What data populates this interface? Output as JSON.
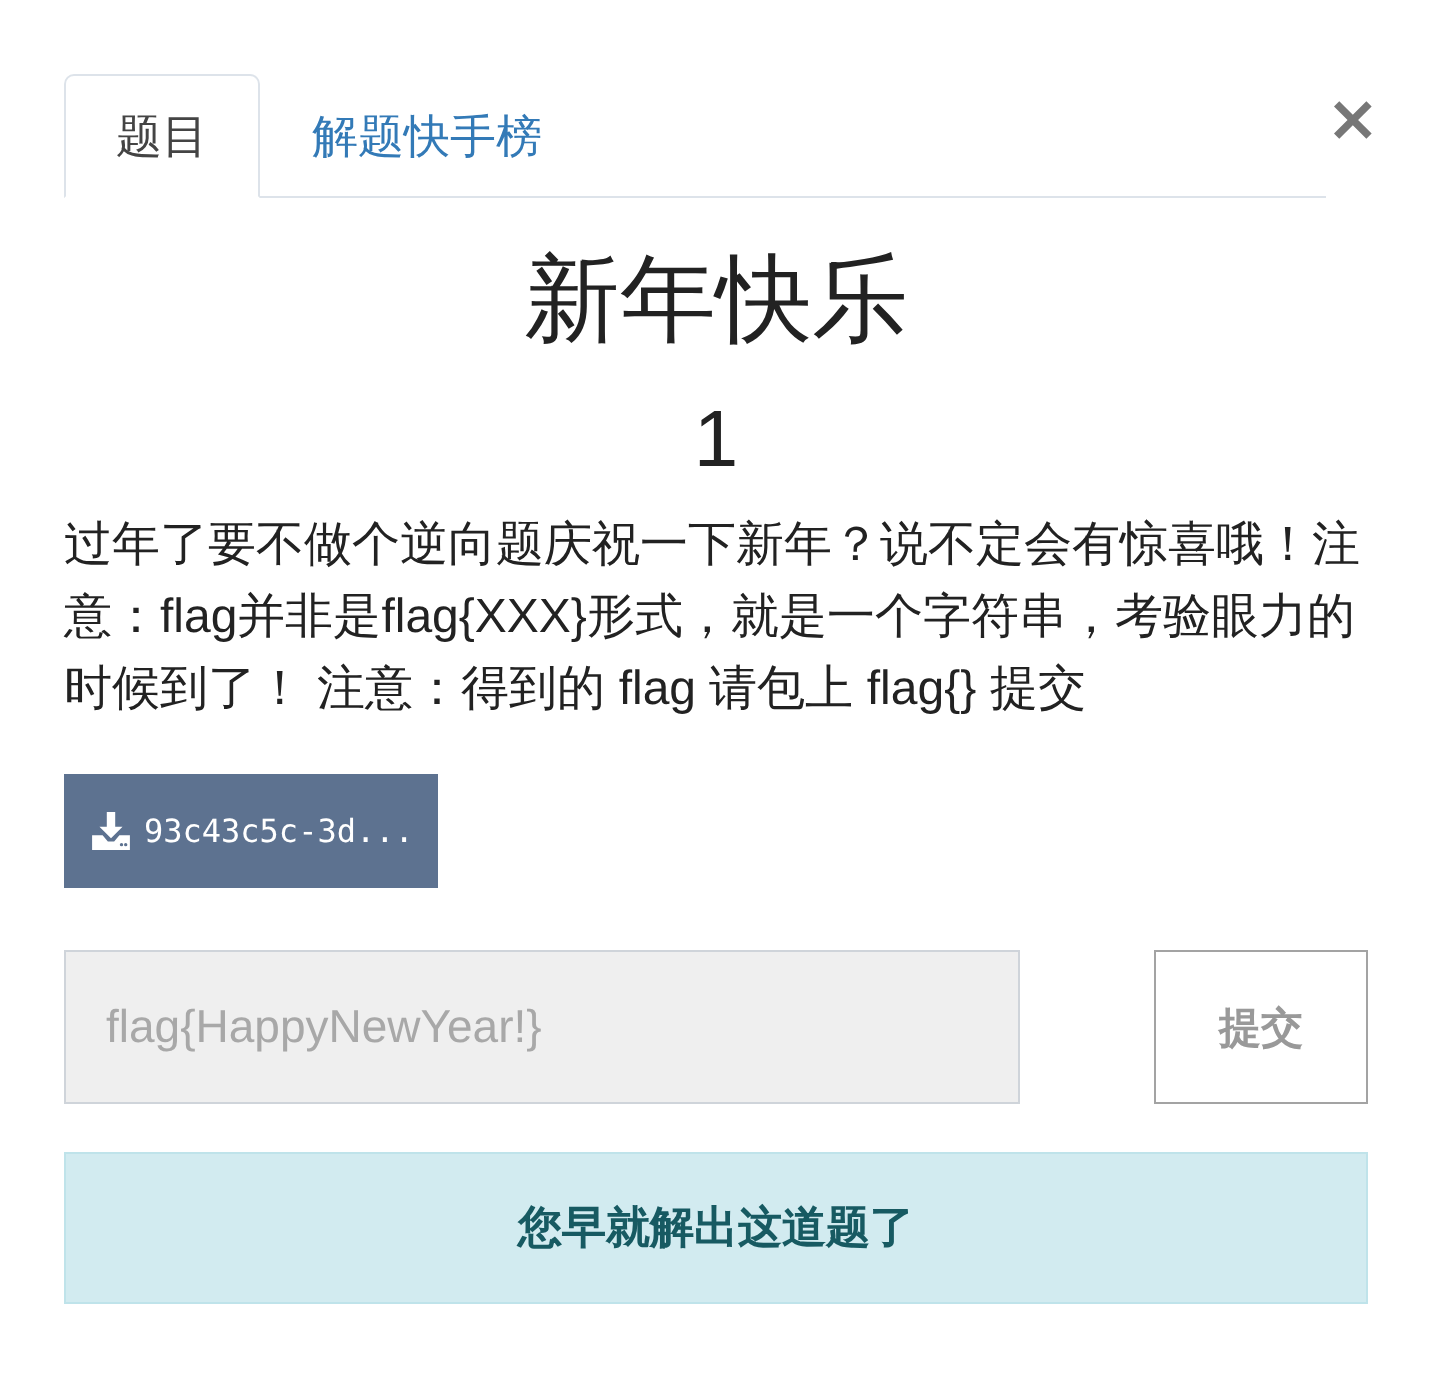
{
  "tabs": [
    {
      "label": "题目",
      "selected": true
    },
    {
      "label": "解题快手榜",
      "selected": false
    }
  ],
  "close": {
    "label": "×"
  },
  "challenge": {
    "title": "新年快乐",
    "value": "1",
    "description": "过年了要不做个逆向题庆祝一下新年？说不定会有惊喜哦！注意：flag并非是flag{XXX}形式，就是一个字符串，考验眼力的时候到了！ 注意：得到的 flag 请包上 flag{} 提交",
    "file": {
      "label": "93c43c5c-3d..."
    }
  },
  "submission": {
    "input": {
      "placeholder": "flag{HappyNewYear!}",
      "disabled": true
    },
    "submit": {
      "label": "提交",
      "disabled": true
    }
  },
  "alert": {
    "message": "您早就解出这道题了"
  }
}
